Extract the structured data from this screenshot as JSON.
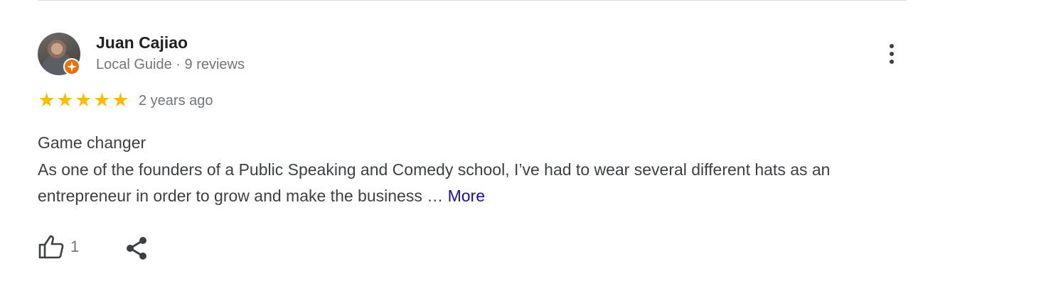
{
  "reviewer": {
    "name": "Juan Cajiao",
    "meta": "Local Guide · 9 reviews",
    "avatar_icon": "avatar-photo",
    "badge_icon": "local-guide-star-icon",
    "badge_color": "#e8710a"
  },
  "review": {
    "rating": 5,
    "rating_max": 5,
    "star_glyph": "★",
    "star_color": "#fbbc04",
    "date": "2 years ago",
    "title": "Game changer",
    "body": "As one of the founders of a Public Speaking and Comedy school, I’ve had to wear several different hats as an entrepreneur in order to grow and make the business … ",
    "more_label": "More",
    "link_color": "#1a0dab"
  },
  "actions": {
    "like_icon": "thumbs-up-icon",
    "like_count": "1",
    "share_icon": "share-icon",
    "menu_icon": "more-vertical-icon"
  }
}
